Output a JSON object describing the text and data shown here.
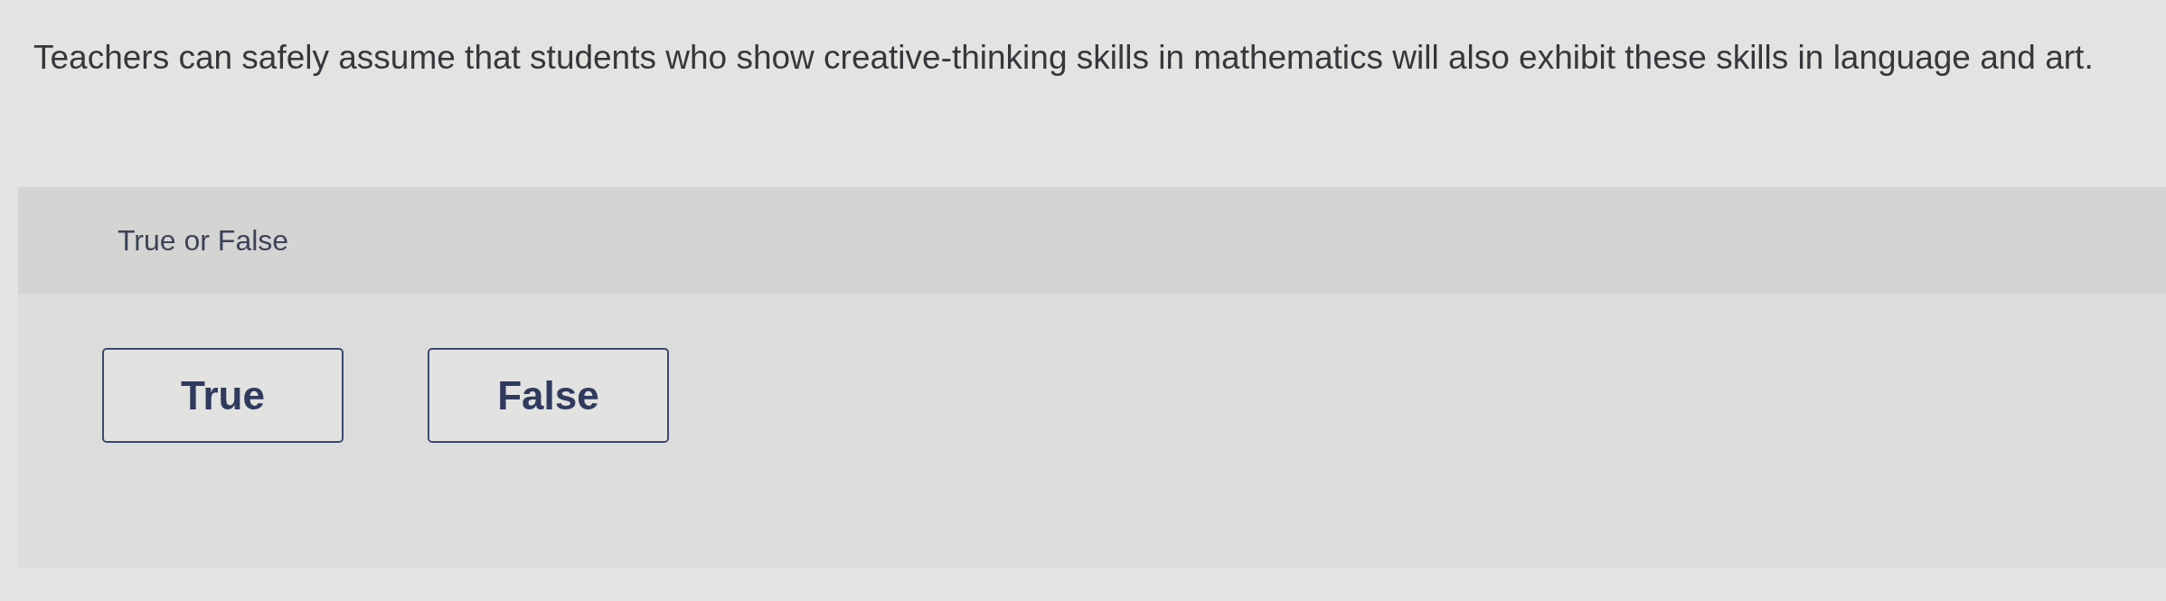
{
  "question": {
    "text": "Teachers can safely assume that students who show creative-thinking skills in mathematics will also exhibit these skills in language and art."
  },
  "prompt": {
    "label": "True or False"
  },
  "options": [
    {
      "label": "True",
      "selected": false
    },
    {
      "label": "False",
      "selected": false
    }
  ]
}
